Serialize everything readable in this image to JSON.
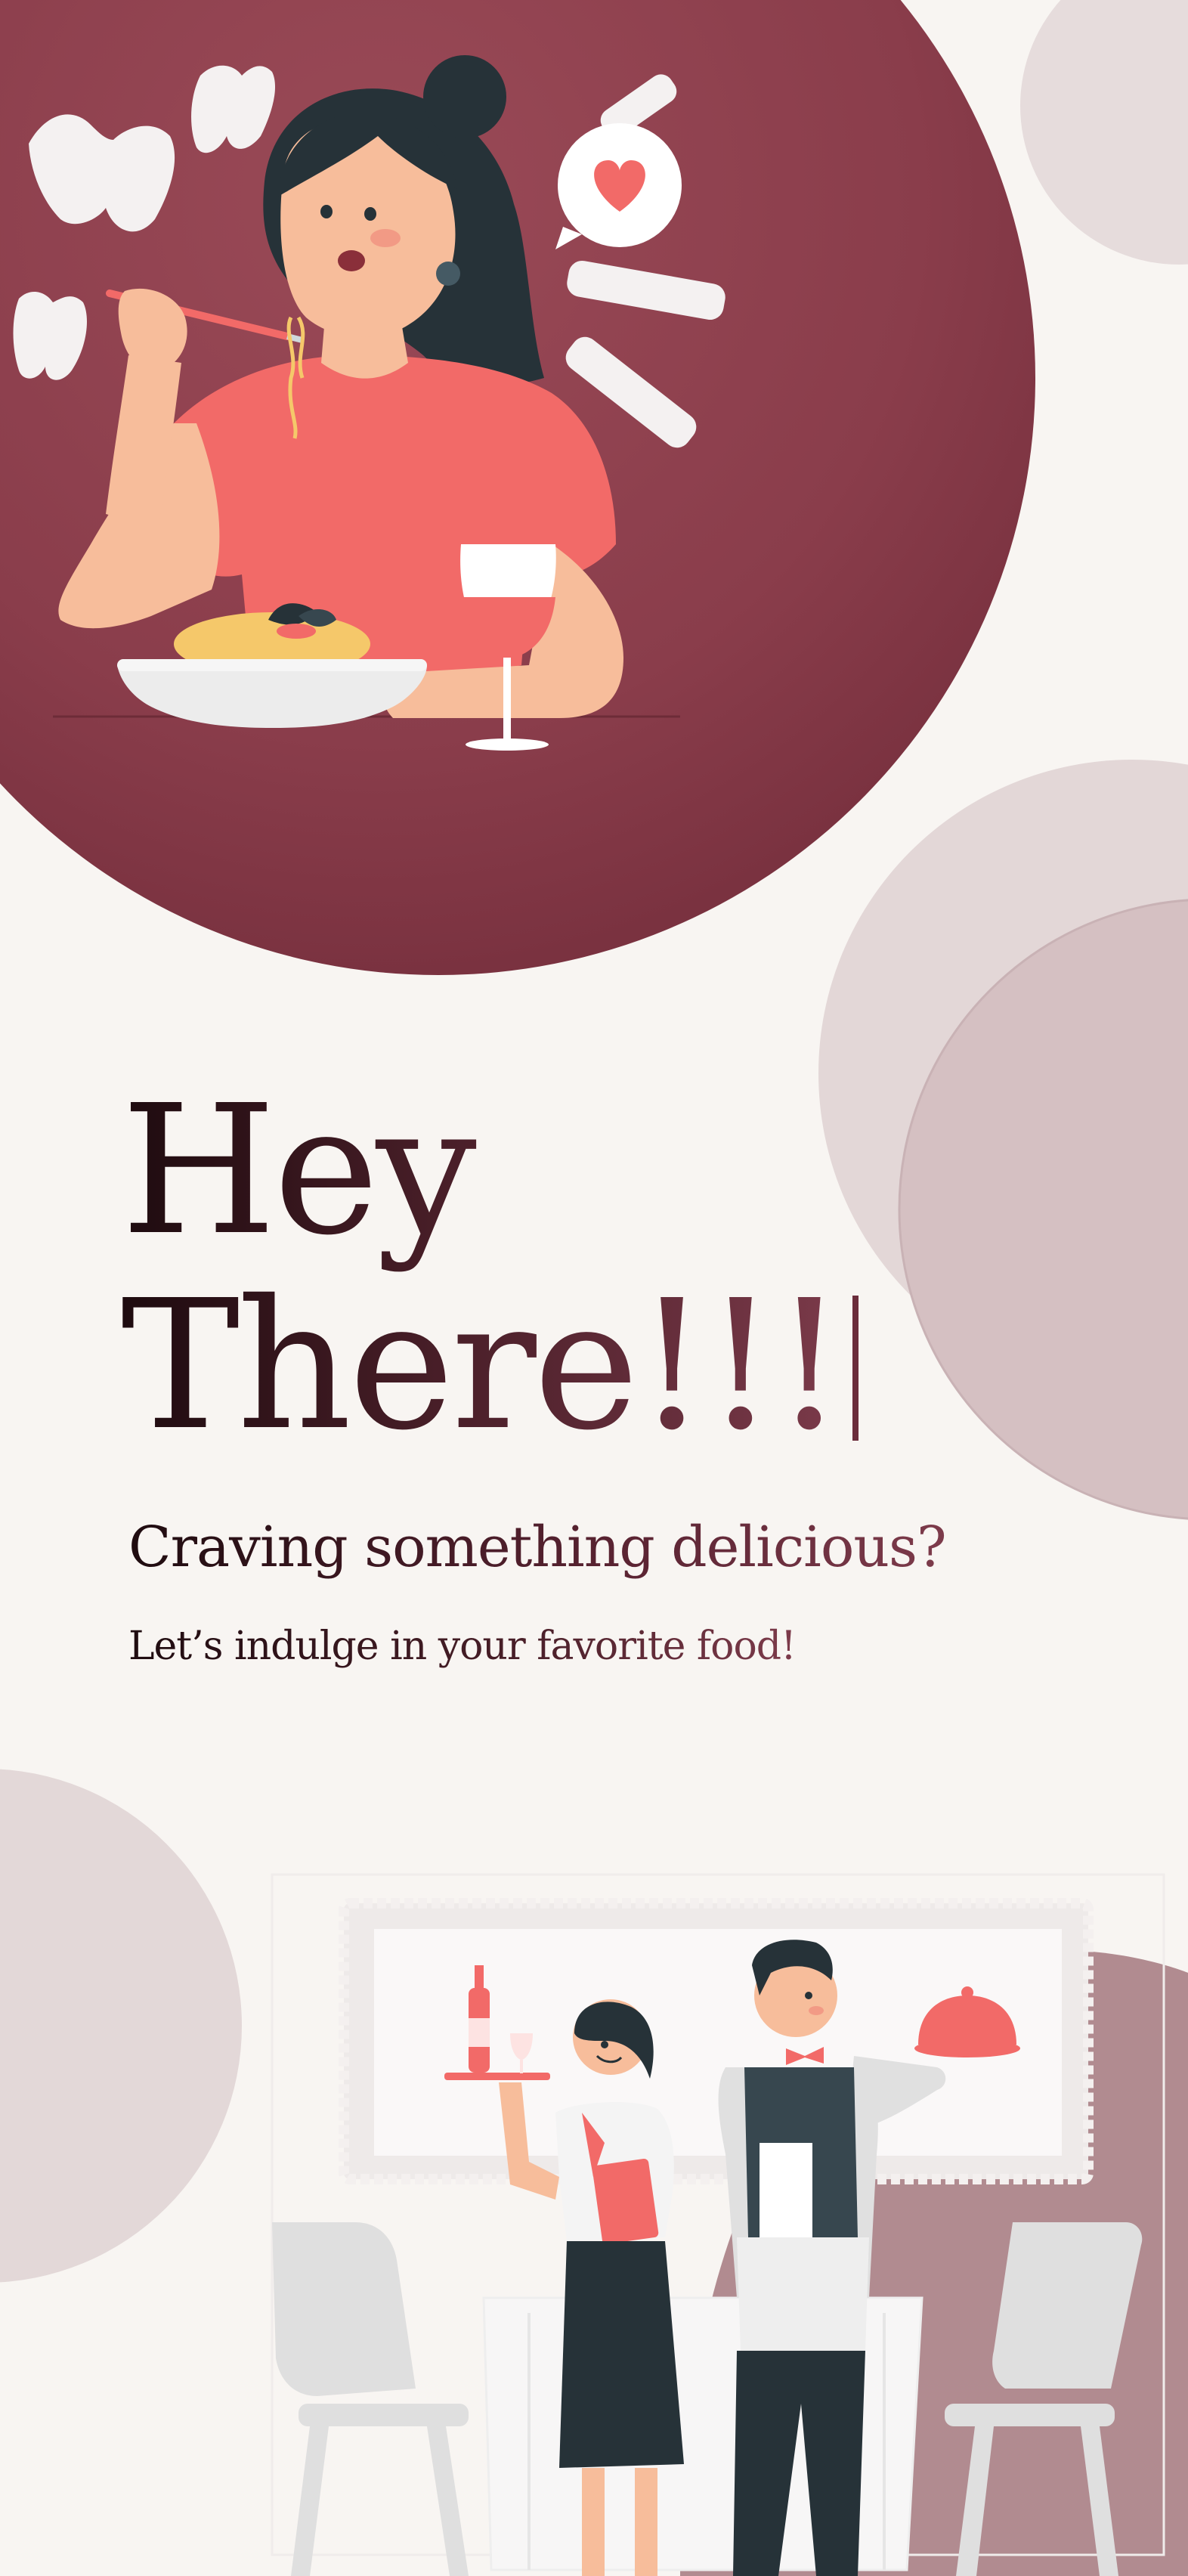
{
  "greeting": {
    "line1": "Hey",
    "line2": "There!!!"
  },
  "subtitle": "Craving something delicious?",
  "tagline": "Let’s indulge in your favorite food!",
  "colors": {
    "background": "#f8f5f2",
    "hero_circle": "#8a3d4b",
    "accent_coral": "#f26a68",
    "text_dark": "#1e0b0f",
    "text_wine": "#7d3b4b",
    "soft_circle": "#e2d7d7"
  },
  "illustrations": {
    "top": "woman-eating-pasta",
    "bottom": "waiters-serving"
  }
}
